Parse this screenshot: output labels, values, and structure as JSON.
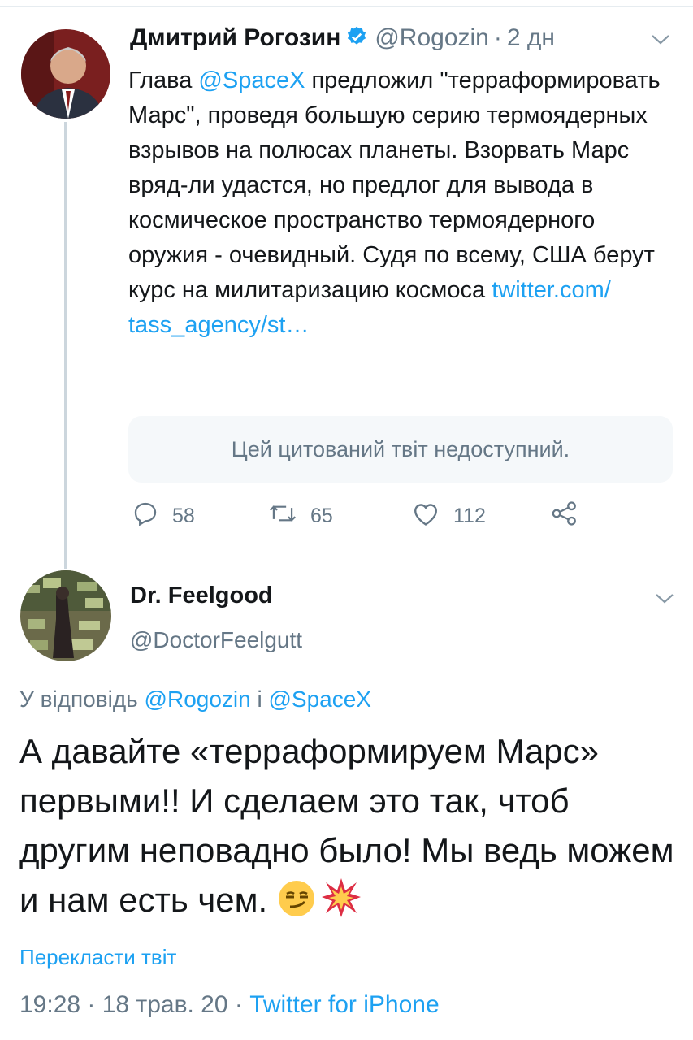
{
  "tweet1": {
    "author_name": "Дмитрий Рогозин",
    "handle": "@Rogozin",
    "separator": "·",
    "age": "2 дн",
    "text_part1": "Глава ",
    "mention": "@SpaceX",
    "text_part2": " предложил \"терраформировать Марс\", проведя большую серию термоядерных взрывов на полюсах планеты. Взорвать Марс вряд-ли удастся, но предлог для вывода в космическое пространство термоядерного оружия - очевидный. Судя по всему, США берут курс на милитаризацию космоса ",
    "link_text": "twitter.com/ tass_agency/st…",
    "quote_unavailable": "Цей цитований твіт недоступний.",
    "stats": {
      "replies": "58",
      "retweets": "65",
      "likes": "112"
    }
  },
  "tweet2": {
    "author_name": "Dr. Feelgood",
    "handle": "@DoctorFeelgutt",
    "reply_prefix": "У відповідь ",
    "reply_user1": "@Rogozin",
    "reply_and": " і ",
    "reply_user2": "@SpaceX",
    "text": "А давайте «терраформируем Марс» первыми!! И сделаем это так, чтоб другим неповадно было! Мы ведь можем и нам есть чем. ",
    "emojis": [
      "smirking-face-emoji",
      "collision-emoji"
    ],
    "translate": "Перекласти твіт",
    "time": "19:28",
    "date": "18 трав. 20",
    "meta_sep": " · ",
    "source": "Twitter for iPhone"
  },
  "colors": {
    "accent": "#1da1f2",
    "muted": "#657786",
    "text": "#14171a"
  }
}
